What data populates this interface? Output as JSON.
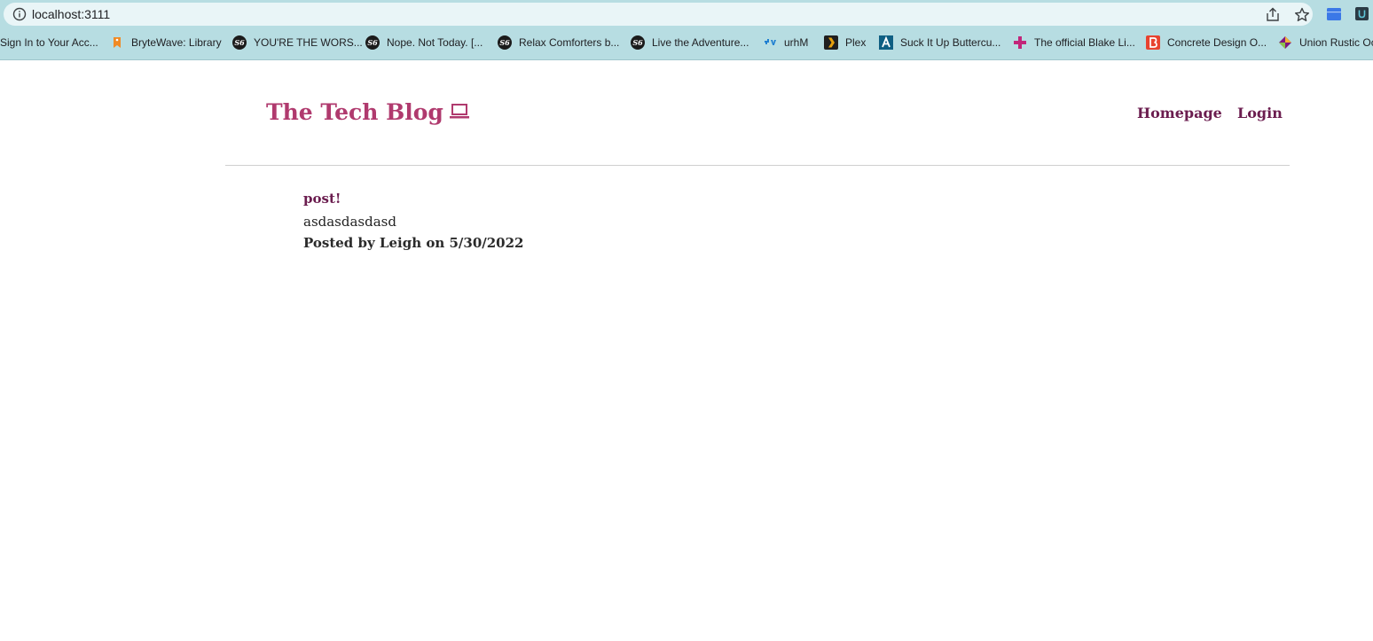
{
  "browser": {
    "url": "localhost:3111",
    "bookmarks": [
      {
        "label": "Sign In to Your Acc...",
        "icon": "none"
      },
      {
        "label": "BryteWave: Library",
        "icon": "brytewave-icon"
      },
      {
        "label": "YOU'RE THE WORS...",
        "icon": "s6-icon"
      },
      {
        "label": "Nope. Not Today. [...",
        "icon": "s6-icon"
      },
      {
        "label": "Relax Comforters b...",
        "icon": "s6-icon"
      },
      {
        "label": "Live the Adventure...",
        "icon": "s6-icon"
      },
      {
        "label": "urhM",
        "icon": "bluecross-icon"
      },
      {
        "label": "Plex",
        "icon": "plex-icon"
      },
      {
        "label": "Suck It Up Buttercu...",
        "icon": "a-logo-icon"
      },
      {
        "label": "The official Blake Li...",
        "icon": "pink-cross-icon"
      },
      {
        "label": "Concrete Design O...",
        "icon": "b-logo-icon"
      },
      {
        "label": "Union Rustic Oc",
        "icon": "wayfair-icon"
      }
    ]
  },
  "site": {
    "title": "The Tech Blog",
    "title_icon": "laptop-icon",
    "title_color": "#b03a6e",
    "nav": {
      "homepage": "Homepage",
      "login": "Login"
    },
    "nav_color": "#6b1d4f"
  },
  "posts": [
    {
      "title": "post!",
      "body": "asdasdasdasd",
      "meta": "Posted by Leigh on 5/30/2022"
    }
  ]
}
